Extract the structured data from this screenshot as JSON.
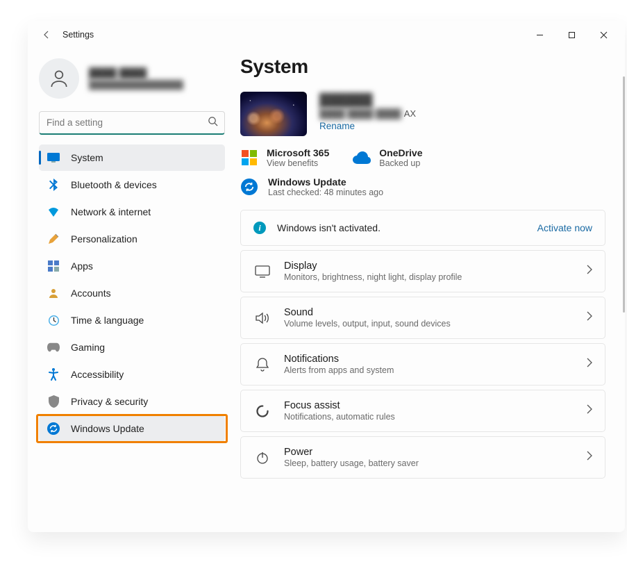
{
  "window": {
    "title": "Settings"
  },
  "profile": {
    "name": "████ ████",
    "email": "████████████████"
  },
  "search": {
    "placeholder": "Find a setting"
  },
  "sidebar": {
    "items": [
      {
        "label": "System",
        "icon": "system",
        "active": true
      },
      {
        "label": "Bluetooth & devices",
        "icon": "bluetooth"
      },
      {
        "label": "Network & internet",
        "icon": "network"
      },
      {
        "label": "Personalization",
        "icon": "personalize"
      },
      {
        "label": "Apps",
        "icon": "apps"
      },
      {
        "label": "Accounts",
        "icon": "accounts"
      },
      {
        "label": "Time & language",
        "icon": "time"
      },
      {
        "label": "Gaming",
        "icon": "gaming"
      },
      {
        "label": "Accessibility",
        "icon": "accessibility"
      },
      {
        "label": "Privacy & security",
        "icon": "privacy"
      },
      {
        "label": "Windows Update",
        "icon": "update",
        "highlighted": true
      }
    ]
  },
  "page": {
    "title": "System"
  },
  "device": {
    "name": "██████",
    "model": "████ ████ ████",
    "suffix": "AX",
    "rename": "Rename"
  },
  "status": {
    "ms365": {
      "title": "Microsoft 365",
      "sub": "View benefits"
    },
    "onedrive": {
      "title": "OneDrive",
      "sub": "Backed up"
    },
    "update": {
      "title": "Windows Update",
      "sub": "Last checked: 48 minutes ago"
    }
  },
  "notice": {
    "text": "Windows isn't activated.",
    "action": "Activate now"
  },
  "settings": [
    {
      "title": "Display",
      "sub": "Monitors, brightness, night light, display profile",
      "icon": "display"
    },
    {
      "title": "Sound",
      "sub": "Volume levels, output, input, sound devices",
      "icon": "sound"
    },
    {
      "title": "Notifications",
      "sub": "Alerts from apps and system",
      "icon": "notifications"
    },
    {
      "title": "Focus assist",
      "sub": "Notifications, automatic rules",
      "icon": "focus"
    },
    {
      "title": "Power",
      "sub": "Sleep, battery usage, battery saver",
      "icon": "power"
    }
  ]
}
